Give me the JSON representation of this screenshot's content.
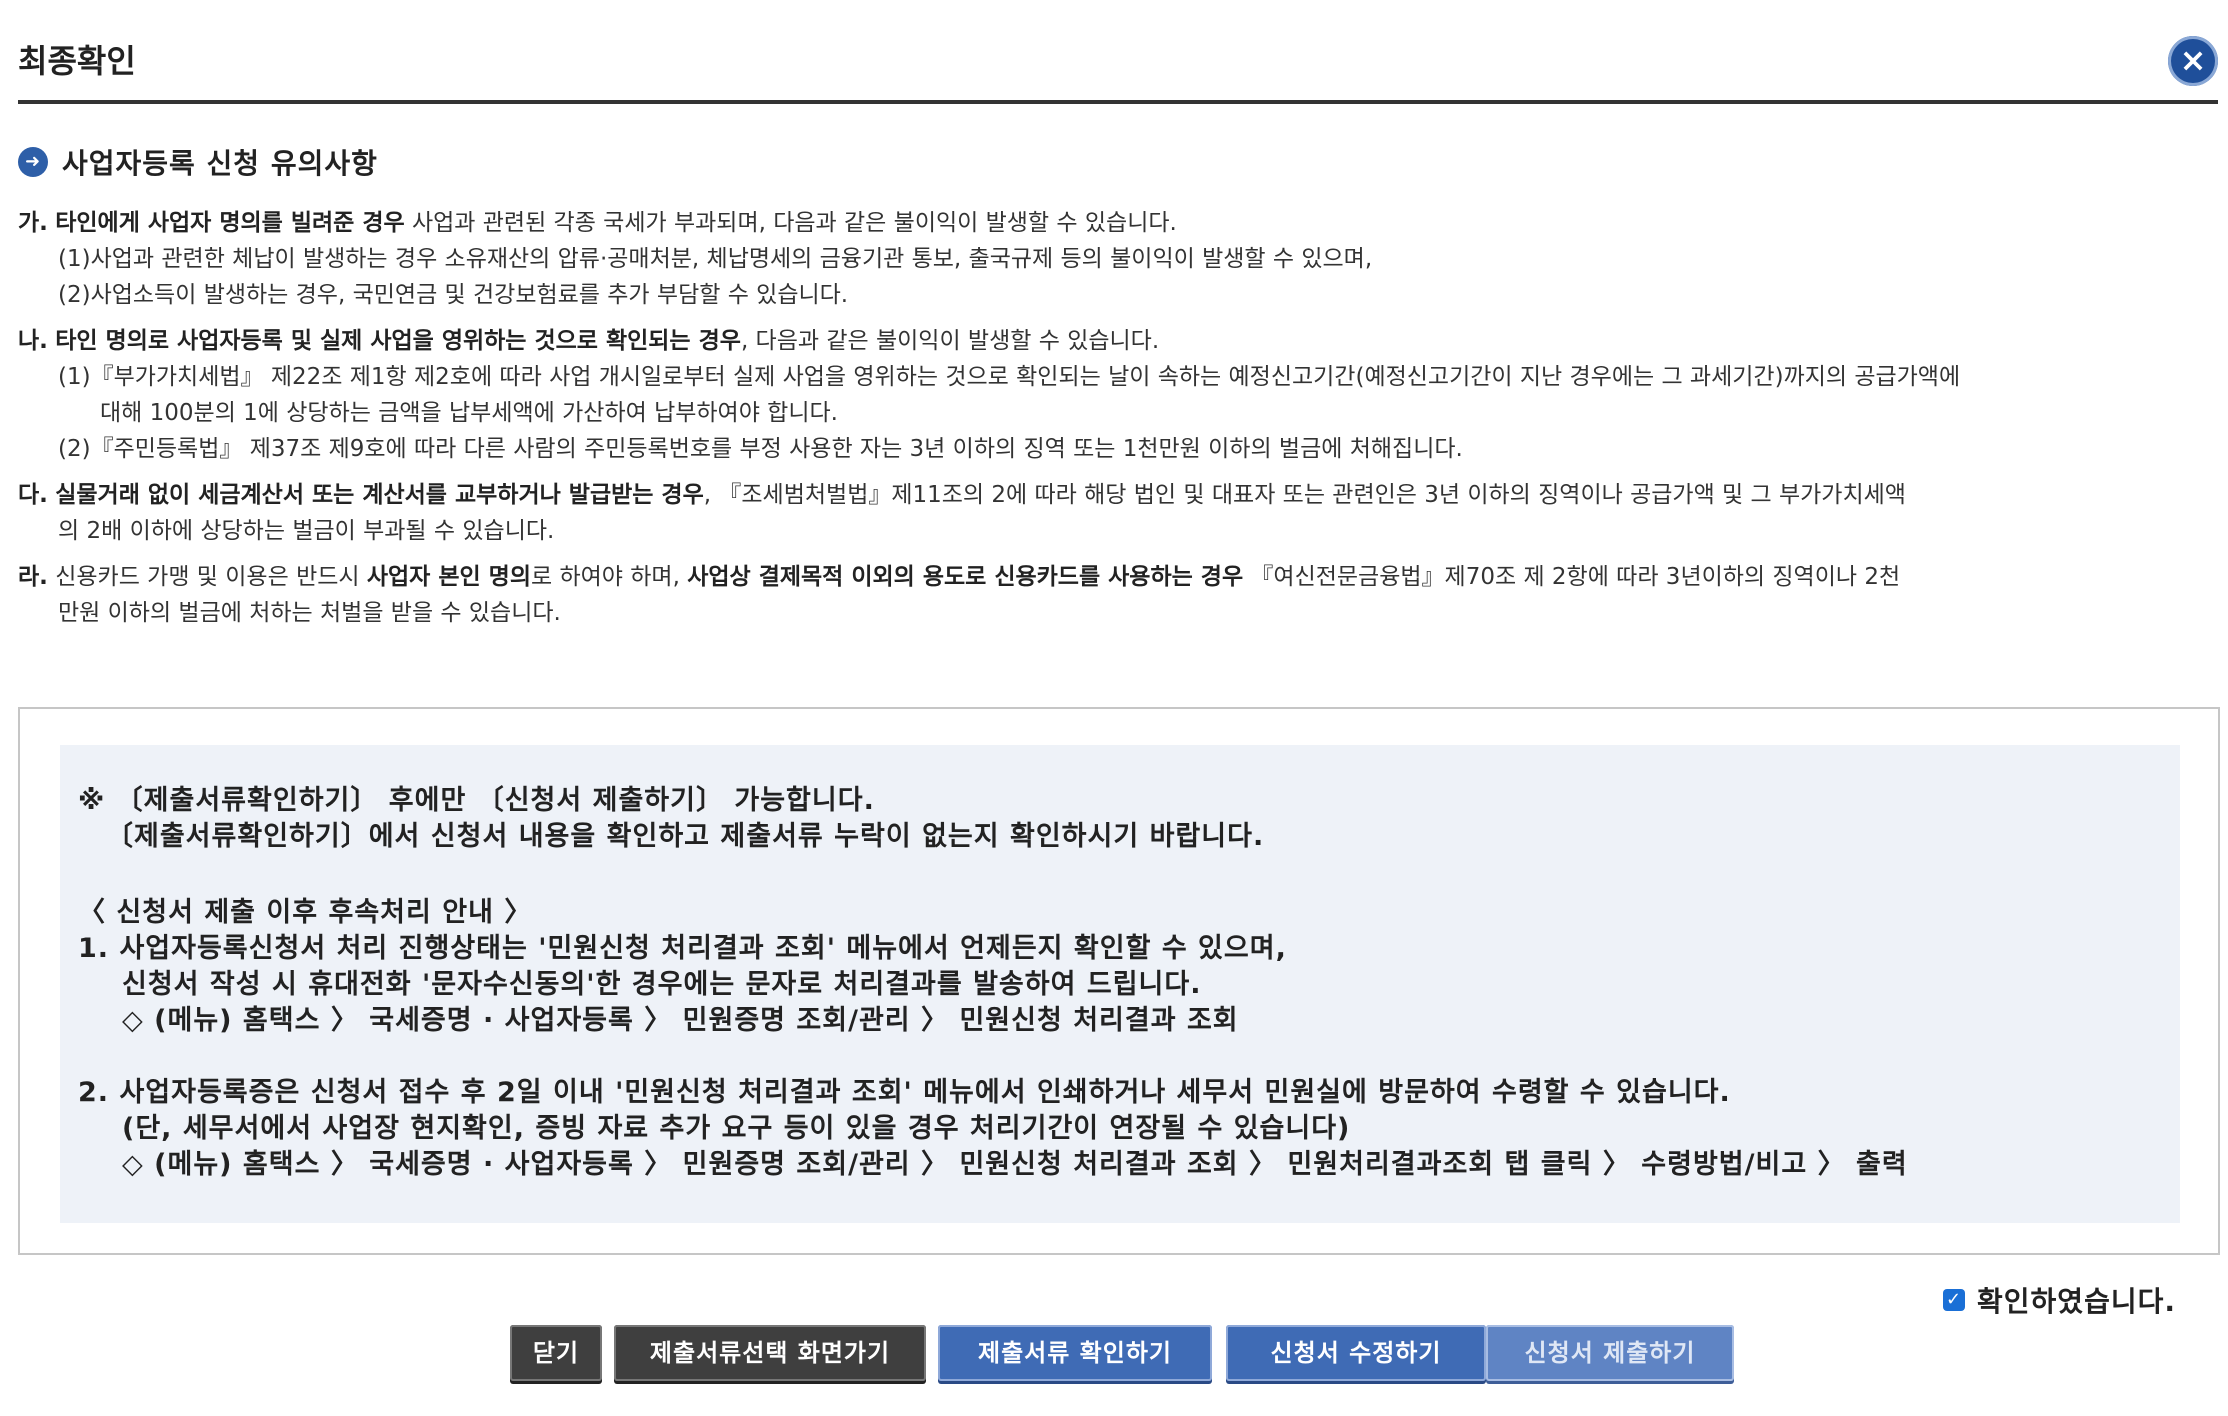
{
  "header": {
    "title": "최종확인",
    "close_label": "×"
  },
  "section": {
    "title": "사업자등록 신청 유의사항",
    "icon": "arrow-right-icon"
  },
  "notices": [
    [
      {
        "lead": "가.",
        "bold": "타인에게 사업자 명의를 빌려준 경우",
        "text": " 사업과 관련된 각종 국세가 부과되며, 다음과 같은 불이익이 발생할 수 있습니다."
      },
      {
        "text": "(1)사업과 관련한 체납이 발생하는 경우 소유재산의 압류·공매처분, 체납명세의 금융기관 통보, 출국규제 등의 불이익이 발생할 수 있으며,"
      },
      {
        "text": "(2)사업소득이 발생하는 경우, 국민연금 및 건강보험료를 추가 부담할 수 있습니다."
      }
    ],
    [
      {
        "lead": "나.",
        "bold": "타인 명의로 사업자등록 및 실제 사업을 영위하는 것으로 확인되는 경우",
        "text": ", 다음과 같은 불이익이 발생할 수 있습니다."
      },
      {
        "text": "(1)『부가가치세법』 제22조 제1항 제2호에 따라 사업 개시일로부터 실제 사업을 영위하는 것으로 확인되는 날이 속하는 예정신고기간(예정신고기간이 지난 경우에는 그 과세기간)까지의 공급가액에"
      },
      {
        "text": "대해 100분의 1에 상당하는 금액을 납부세액에 가산하여 납부하여야 합니다."
      },
      {
        "text": "(2)『주민등록법』 제37조 제9호에 따라 다른 사람의 주민등록번호를 부정 사용한 자는 3년 이하의 징역 또는 1천만원 이하의 벌금에 처해집니다."
      }
    ],
    [
      {
        "lead": "다.",
        "bold": "실물거래 없이 세금계산서 또는 계산서를 교부하거나 발급받는 경우",
        "text": ", 『조세범처벌법』제11조의 2에 따라 해당 법인 및 대표자 또는 관련인은 3년 이하의 징역이나 공급가액 및 그 부가가치세액"
      },
      {
        "text": "의 2배 이하에 상당하는 벌금이 부과될 수 있습니다."
      }
    ],
    [
      {
        "lead": "라.",
        "text": "신용카드 가맹 및 이용은 반드시 ",
        "bold": "사업자 본인 명의",
        "text2": "로 하여야 하며, ",
        "bold2": "사업상 결제목적 이외의 용도로 신용카드를 사용하는 경우",
        "text3": " 『여신전문금융법』제70조 제 2항에 따라 3년이하의 징역이나 2천"
      },
      {
        "text": "만원 이하의 벌금에 처하는 처벌을 받을 수 있습니다."
      }
    ]
  ],
  "info": {
    "l1": "※ 〔제출서류확인하기〕 후에만 〔신청서 제출하기〕 가능합니다.",
    "l2": "〔제출서류확인하기〕에서 신청서 내용을 확인하고 제출서류 누락이 없는지 확인하시기 바랍니다.",
    "l3": "〈 신청서 제출 이후 후속처리 안내 〉",
    "l4": "1. 사업자등록신청서 처리 진행상태는 '민원신청 처리결과 조회' 메뉴에서 언제든지 확인할 수 있으며,",
    "l5": "신청서 작성 시 휴대전화 '문자수신동의'한 경우에는 문자로 처리결과를 발송하여 드립니다.",
    "l6": "◇ (메뉴) 홈택스 〉 국세증명 · 사업자등록 〉 민원증명 조회/관리 〉 민원신청 처리결과 조회",
    "l7": "2. 사업자등록증은 신청서 접수 후 2일 이내 '민원신청 처리결과 조회' 메뉴에서 인쇄하거나 세무서 민원실에 방문하여 수령할 수 있습니다.",
    "l8": "(단, 세무서에서 사업장 현지확인, 증빙 자료 추가 요구 등이 있을 경우 처리기간이 연장될 수 있습니다)",
    "l9": "◇ (메뉴) 홈택스 〉 국세증명 · 사업자등록 〉 민원증명 조회/관리 〉 민원신청 처리결과 조회 〉 민원처리결과조회 탭 클릭 〉 수령방법/비고 〉 출력"
  },
  "confirm": {
    "label": "확인하였습니다.",
    "checked": true
  },
  "buttons": {
    "close": "닫기",
    "goto_select": "제출서류선택 화면가기",
    "check_docs": "제출서류 확인하기",
    "edit_app": "신청서 수정하기",
    "submit_app": "신청서 제출하기"
  }
}
